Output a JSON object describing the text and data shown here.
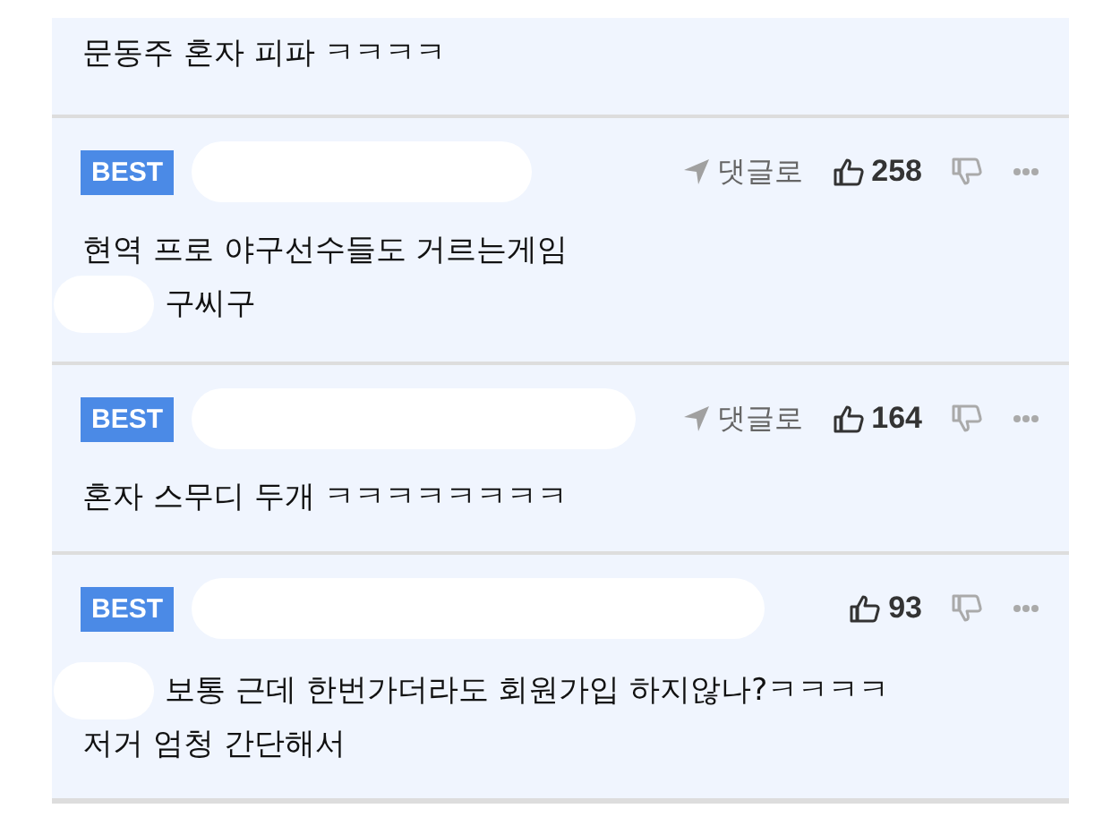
{
  "top_comment": {
    "lines": [
      {
        "text": "문동주 혼자 피파 ㅋㅋㅋㅋ",
        "redacted": false
      }
    ]
  },
  "comments": [
    {
      "best": true,
      "badge": "BEST",
      "reply_label": "댓글로",
      "likes": "258",
      "lines": [
        {
          "text": "현역 프로 야구선수들도 거르는게임",
          "redacted": false
        },
        {
          "text": "구씨구",
          "redacted": true
        }
      ]
    },
    {
      "best": true,
      "badge": "BEST",
      "reply_label": "댓글로",
      "likes": "164",
      "lines": [
        {
          "text": "혼자 스무디 두개 ㅋㅋㅋㅋㅋㅋㅋㅋ",
          "redacted": false
        }
      ]
    },
    {
      "best": true,
      "badge": "BEST",
      "likes": "93",
      "lines": [
        {
          "text": "보통 근데 한번가더라도 회원가입 하지않나?ㅋㅋㅋㅋ",
          "redacted": true
        },
        {
          "text": "저거 엄청 간단해서",
          "redacted": false
        }
      ]
    }
  ]
}
